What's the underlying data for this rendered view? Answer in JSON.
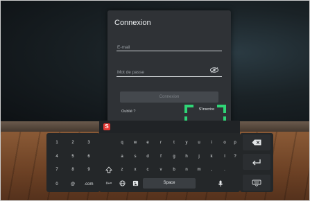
{
  "login": {
    "title": "Connexion",
    "email_placeholder": "E-mail",
    "password_placeholder": "Mot de passe",
    "login_button": "Connexion",
    "forgot_link": "Oublié ?",
    "signup_link": "S'inscrire"
  },
  "keyboard": {
    "logo": "S",
    "numpad": [
      [
        "1",
        "2",
        "3"
      ],
      [
        "4",
        "5",
        "6"
      ],
      [
        "7",
        "8",
        "9"
      ],
      [
        "0",
        "@",
        ".com"
      ]
    ],
    "letters_row1": [
      "q",
      "w",
      "e",
      "r",
      "t",
      "y",
      "u",
      "i",
      "o",
      "p"
    ],
    "letters_row2": [
      "a",
      "s",
      "d",
      "f",
      "g",
      "h",
      "j",
      "k",
      "l",
      "?"
    ],
    "letters_row3": [
      "z",
      "x",
      "c",
      "v",
      "b",
      "n",
      "m",
      ",",
      "."
    ],
    "symbols_key": "#+=",
    "space_label": "Space"
  },
  "colors": {
    "highlight": "#2fd576",
    "logo": "#e53935"
  }
}
